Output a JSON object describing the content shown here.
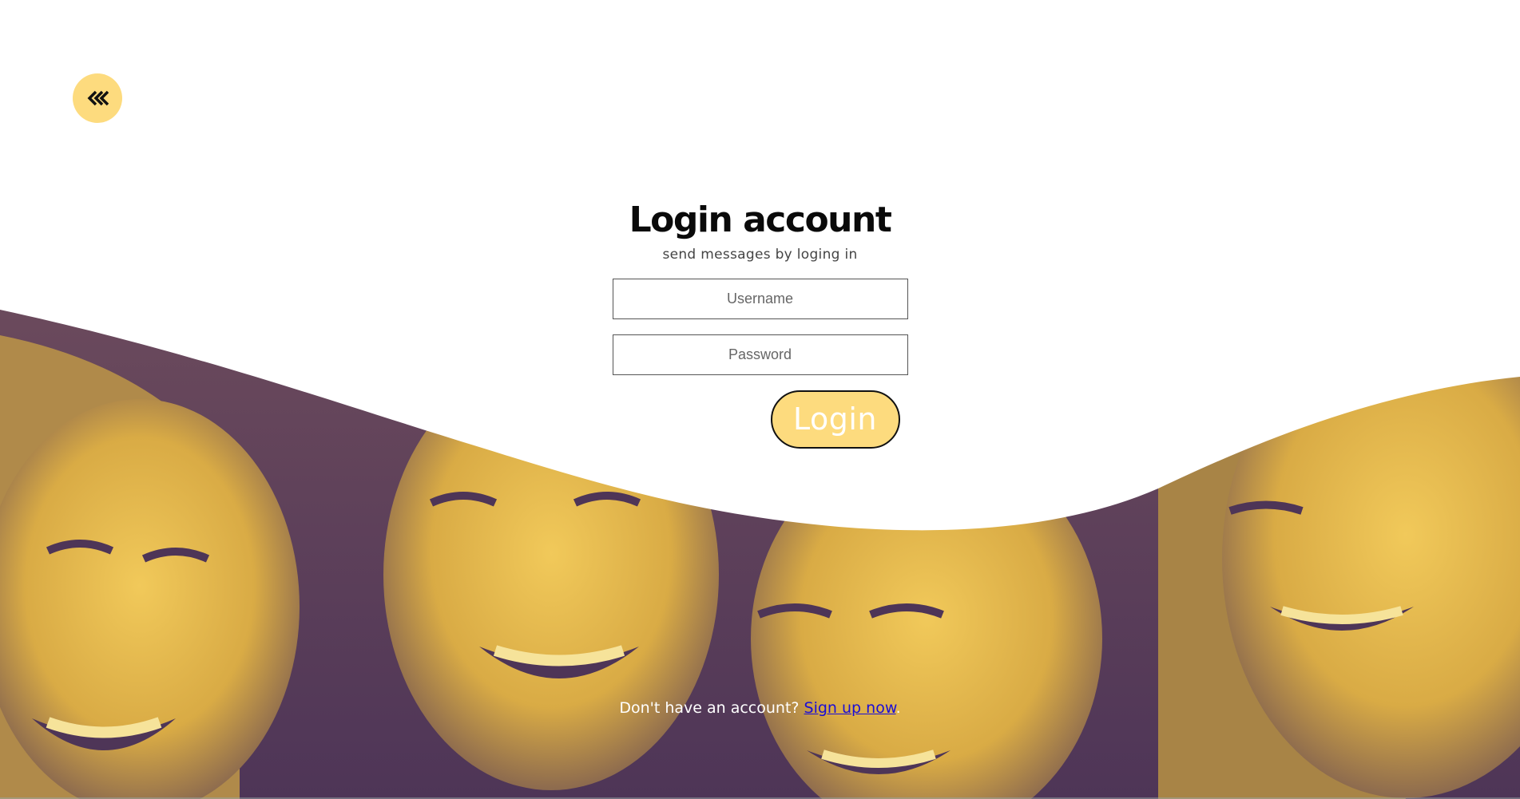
{
  "back": {
    "icon": "double-chevron-left-icon"
  },
  "login": {
    "title": "Login account",
    "subtitle": "send messages by loging in",
    "username_placeholder": "Username",
    "password_placeholder": "Password",
    "button_label": "Login"
  },
  "signup": {
    "prompt": "Don't have an account?",
    "link_label": "Sign up now",
    "suffix": "."
  },
  "colors": {
    "accent": "#fddb7e",
    "duotone_light": "#e4b94e",
    "duotone_dark": "#5a3c5e",
    "link": "#1a0dd6"
  },
  "hero": {
    "image": "smiling-friends-duotone-photo"
  }
}
